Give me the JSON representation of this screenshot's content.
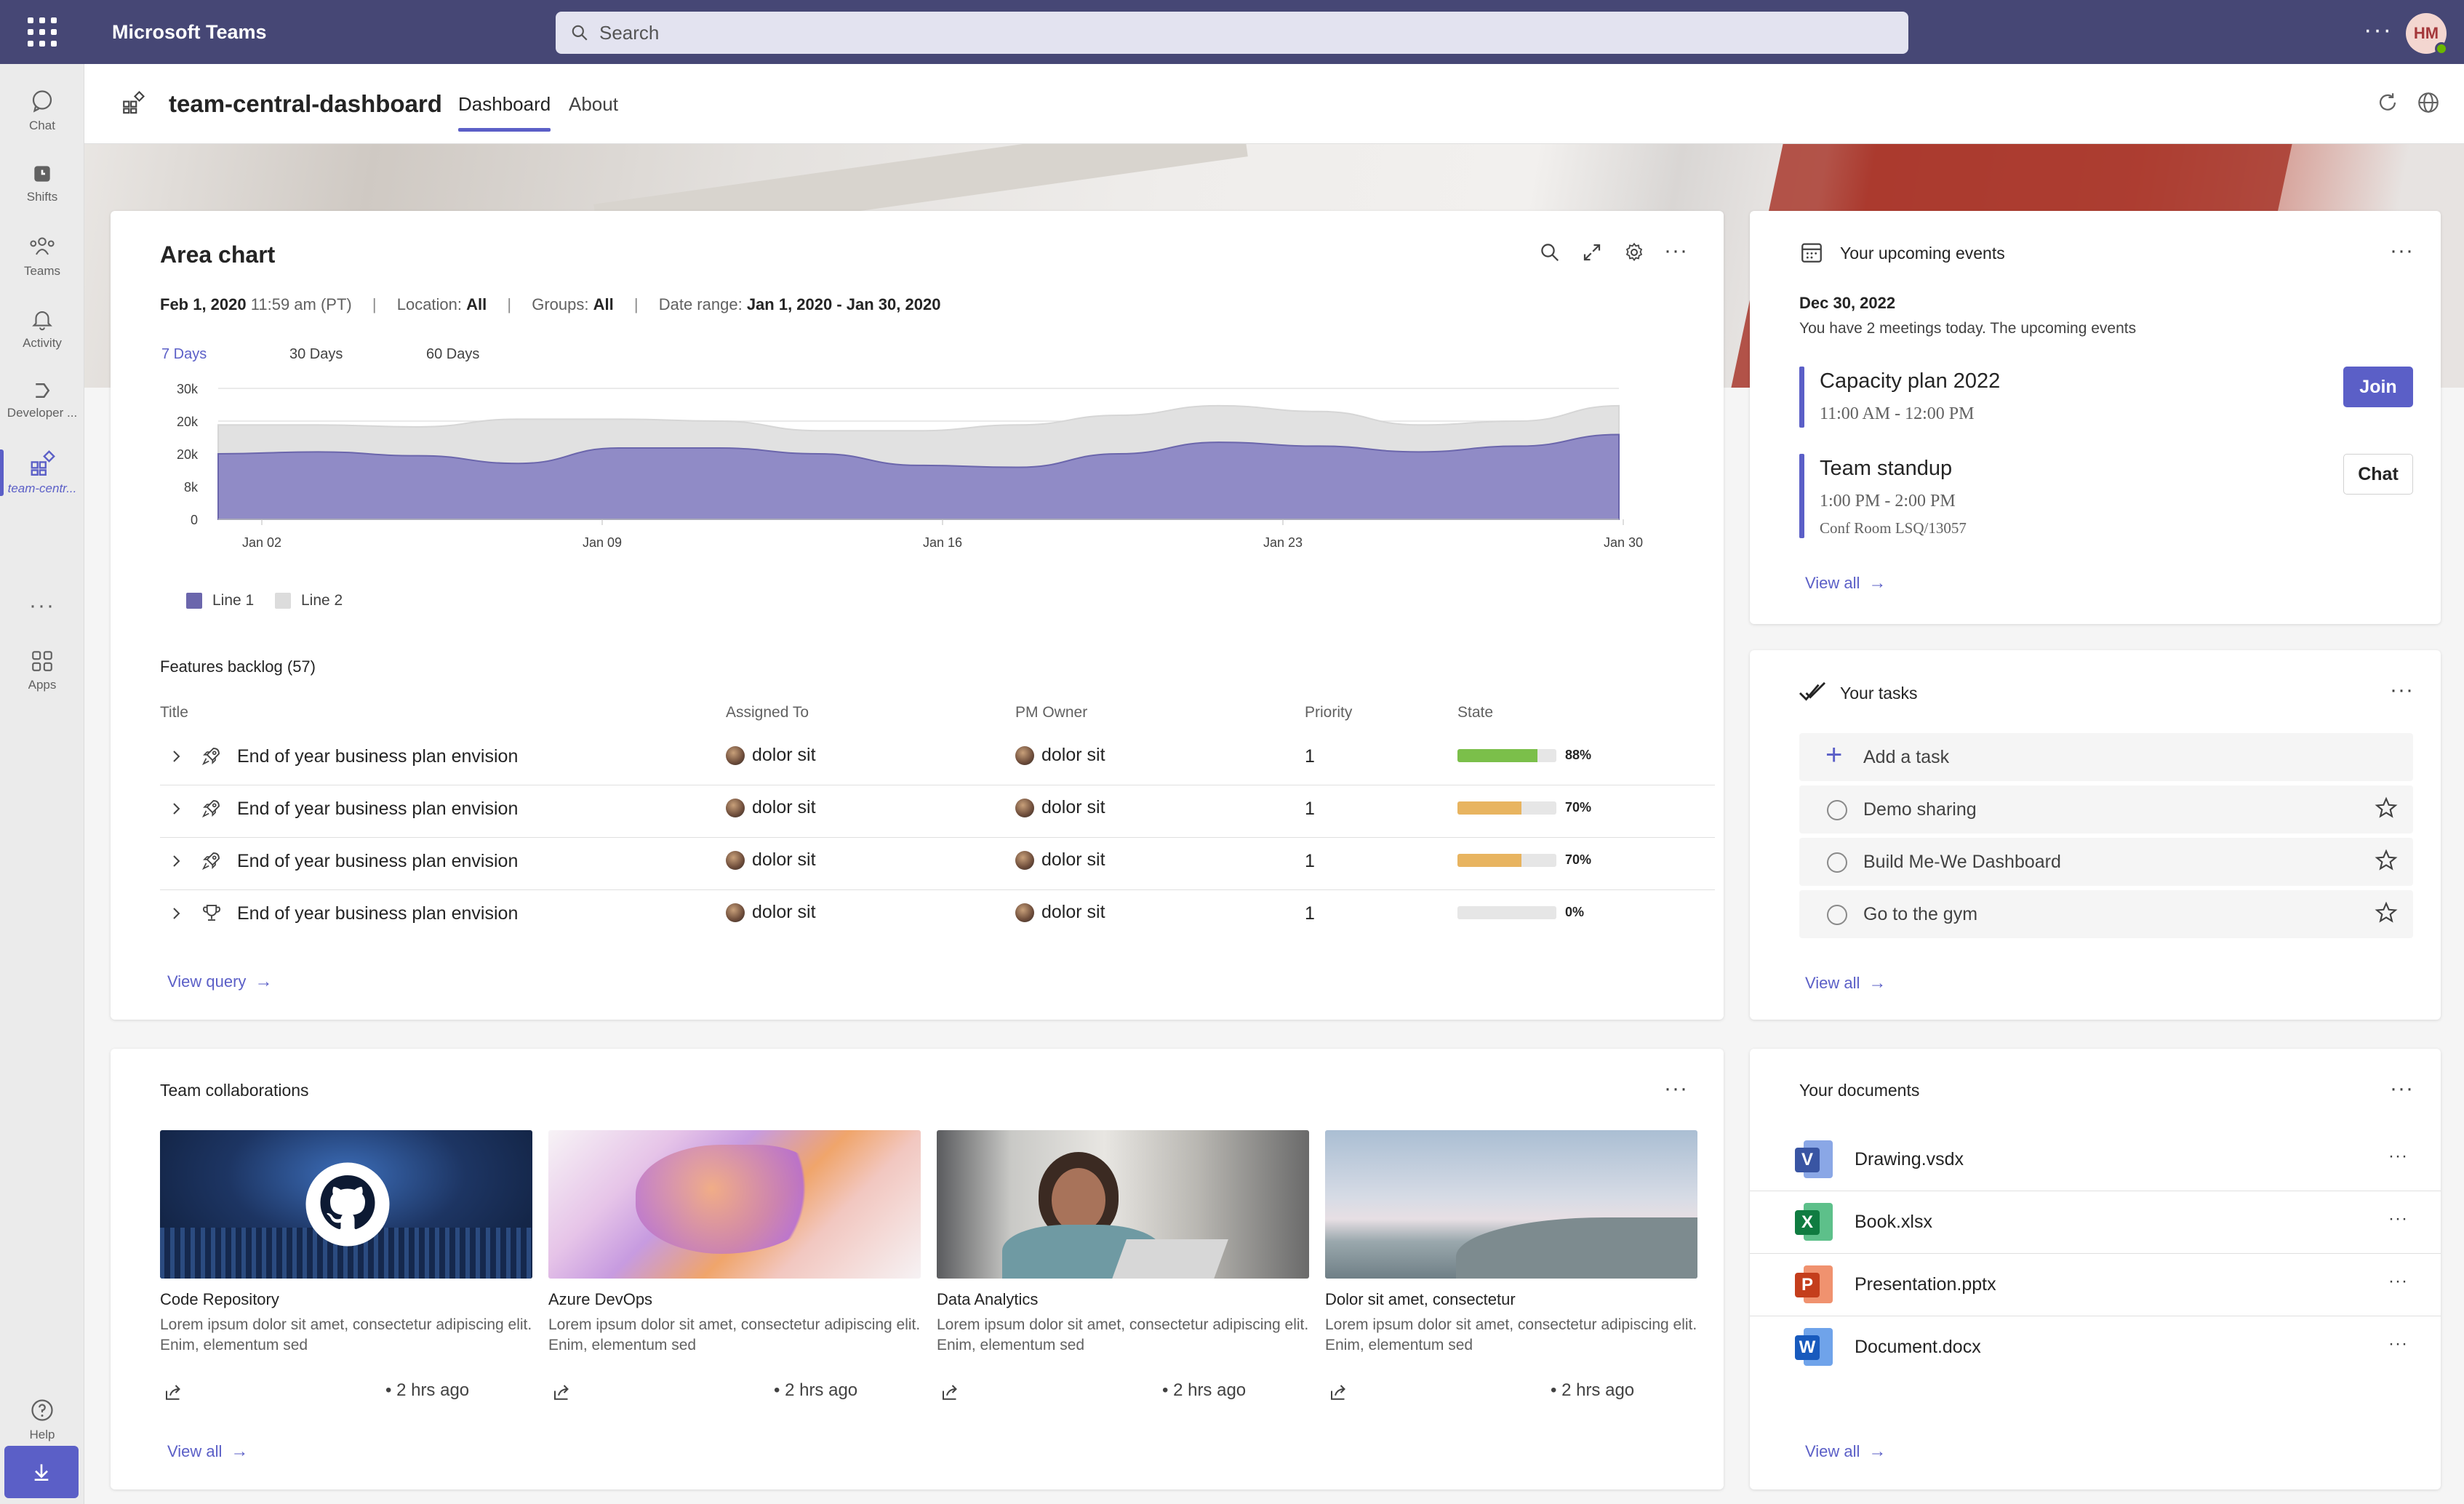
{
  "app": {
    "title": "Microsoft Teams",
    "search_placeholder": "Search",
    "user_initials": "HM"
  },
  "rail": {
    "items": [
      {
        "label": "Chat",
        "icon": "chat-icon"
      },
      {
        "label": "Shifts",
        "icon": "shifts-icon"
      },
      {
        "label": "Teams",
        "icon": "teams-icon"
      },
      {
        "label": "Activity",
        "icon": "bell-icon"
      },
      {
        "label": "Developer ...",
        "icon": "developer-icon"
      },
      {
        "label": "team-centr...",
        "icon": "app-grid-icon"
      },
      {
        "label": "Apps",
        "icon": "apps-icon"
      },
      {
        "label": "Help",
        "icon": "help-icon"
      }
    ]
  },
  "header": {
    "app_name": "team-central-dashboard",
    "tabs": [
      {
        "label": "Dashboard",
        "active": true
      },
      {
        "label": "About",
        "active": false
      }
    ]
  },
  "area_chart_card": {
    "title": "Area chart",
    "meta": {
      "date": "Feb 1, 2020",
      "time": "11:59 am (PT)",
      "location_label": "Location:",
      "location_value": "All",
      "groups_label": "Groups:",
      "groups_value": "All",
      "date_range_label": "Date range:",
      "date_range_value": "Jan 1, 2020 - Jan 30, 2020"
    },
    "range_tabs": [
      "7 Days",
      "30 Days",
      "60 Days"
    ],
    "active_range": "7 Days"
  },
  "chart_data": {
    "type": "area",
    "x_ticks": [
      "Jan 02",
      "Jan 09",
      "Jan 16",
      "Jan 23",
      "Jan 30"
    ],
    "y_ticks": [
      "30k",
      "20k",
      "20k",
      "8k",
      "0"
    ],
    "series": [
      {
        "name": "Line 1",
        "color": "#8b86c4",
        "values": [
          17,
          17.5,
          16.5,
          14.5,
          18.5,
          18.5,
          17,
          14,
          13.5,
          17,
          20,
          19,
          17.5,
          19,
          22
        ]
      },
      {
        "name": "Line 2",
        "color": "#e1e1e1",
        "values": [
          24.5,
          24.5,
          24,
          26,
          26,
          25.5,
          23,
          23,
          24.5,
          27,
          29.5,
          28,
          24.5,
          25.5,
          29.5
        ]
      }
    ],
    "ylim": [
      0,
      34
    ],
    "grid": true,
    "legend_position": "bottom-left"
  },
  "backlog": {
    "title": "Features backlog (57)",
    "columns": [
      "Title",
      "Assigned To",
      "PM Owner",
      "Priority",
      "State"
    ],
    "rows": [
      {
        "title": "End of year business plan envision",
        "icon": "rocket-icon",
        "assigned": "dolor sit",
        "pm": "dolor sit",
        "priority": "1",
        "state_pct": "88%",
        "state_value": 0.88,
        "bar_color": "#7bbf4a"
      },
      {
        "title": "End of year business plan envision",
        "icon": "rocket-icon",
        "assigned": "dolor sit",
        "pm": "dolor sit",
        "priority": "1",
        "state_pct": "70%",
        "state_value": 0.7,
        "bar_color": "#e8b460"
      },
      {
        "title": "End of year business plan envision",
        "icon": "rocket-icon",
        "assigned": "dolor sit",
        "pm": "dolor sit",
        "priority": "1",
        "state_pct": "70%",
        "state_value": 0.7,
        "bar_color": "#e8b460"
      },
      {
        "title": "End of year business plan envision",
        "icon": "trophy-icon",
        "assigned": "dolor sit",
        "pm": "dolor sit",
        "priority": "1",
        "state_pct": "0%",
        "state_value": 0,
        "bar_color": "#e6e6e6"
      }
    ],
    "view_link": "View query"
  },
  "events": {
    "title": "Your upcoming events",
    "date": "Dec 30, 2022",
    "summary": "You have 2 meetings today. The upcoming events",
    "items": [
      {
        "name": "Capacity plan 2022",
        "time": "11:00 AM - 12:00 PM",
        "room": "",
        "action": "Join"
      },
      {
        "name": "Team standup",
        "time": "1:00 PM - 2:00 PM",
        "room": "Conf Room LSQ/13057",
        "action": "Chat"
      }
    ],
    "view_link": "View all"
  },
  "tasks": {
    "title": "Your tasks",
    "add_label": "Add a task",
    "items": [
      "Demo sharing",
      "Build Me-We Dashboard",
      "Go to the gym"
    ],
    "view_link": "View all"
  },
  "collaborations": {
    "title": "Team collaborations",
    "items": [
      {
        "name": "Code Repository",
        "desc": "Lorem ipsum dolor sit amet, consectetur adipiscing elit. Enim, elementum sed",
        "ago": "2 hrs ago"
      },
      {
        "name": "Azure DevOps",
        "desc": "Lorem ipsum dolor sit amet, consectetur adipiscing elit. Enim, elementum sed",
        "ago": "2 hrs ago"
      },
      {
        "name": "Data Analytics",
        "desc": "Lorem ipsum dolor sit amet, consectetur adipiscing elit. Enim, elementum sed",
        "ago": "2 hrs ago"
      },
      {
        "name": "Dolor sit amet, consectetur",
        "desc": "Lorem ipsum dolor sit amet, consectetur adipiscing elit. Enim, elementum sed",
        "ago": "2 hrs ago"
      }
    ],
    "view_link": "View all"
  },
  "documents": {
    "title": "Your documents",
    "items": [
      {
        "name": "Drawing.vsdx",
        "letter": "V",
        "color": "#3955a3",
        "back": "#8aa7e6"
      },
      {
        "name": "Book.xlsx",
        "letter": "X",
        "color": "#107c41",
        "back": "#5dc08a"
      },
      {
        "name": "Presentation.pptx",
        "letter": "P",
        "color": "#c43e1c",
        "back": "#f0926f"
      },
      {
        "name": "Document.docx",
        "letter": "W",
        "color": "#185abd",
        "back": "#6fa3ea"
      }
    ],
    "view_link": "View all"
  }
}
